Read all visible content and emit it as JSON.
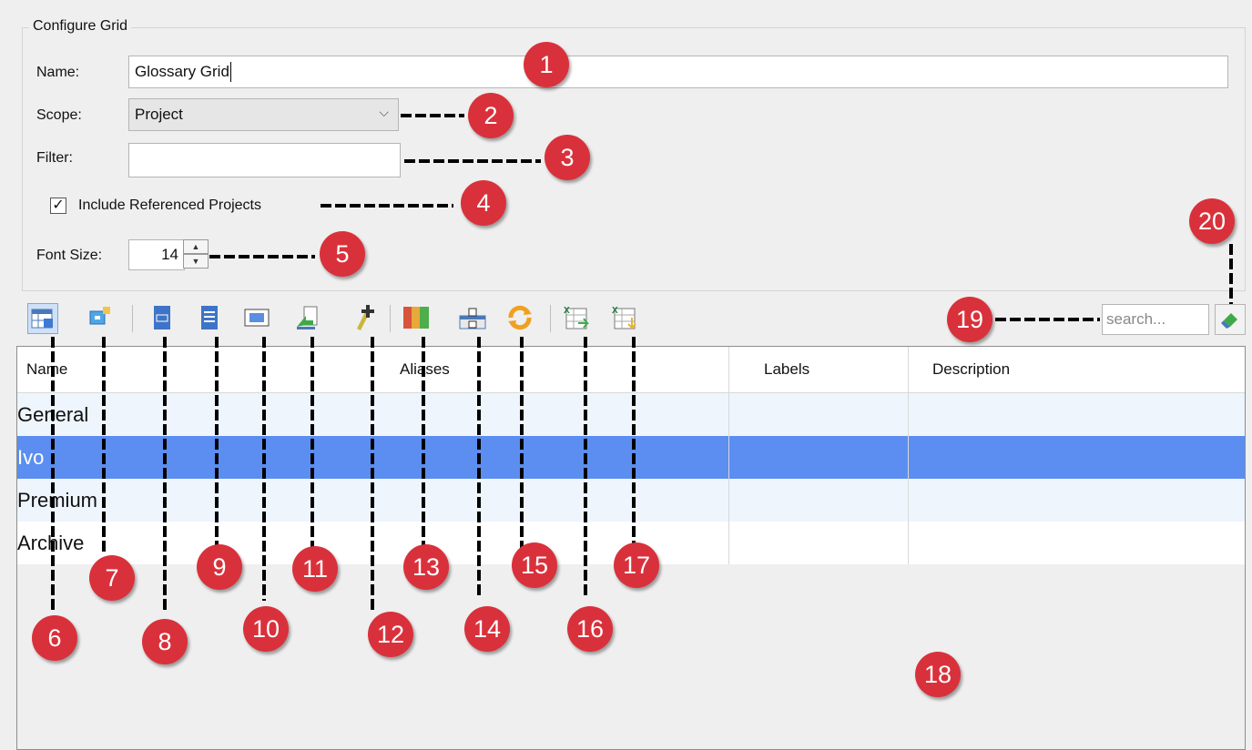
{
  "group_title": "Configure Grid",
  "name_label": "Name:",
  "name_value": "Glossary Grid",
  "scope_label": "Scope:",
  "scope_value": "Project",
  "filter_label": "Filter:",
  "filter_value": "",
  "include_ref_label": "Include Referenced Projects",
  "include_ref_checked": true,
  "font_size_label": "Font Size:",
  "font_size_value": "14",
  "search_placeholder": "search...",
  "columns": [
    "Name",
    "Aliases",
    "Labels",
    "Description"
  ],
  "rows": [
    "General",
    "Ivo",
    "Premium",
    "Archive"
  ],
  "selected_row": "Ivo",
  "toolbar_icons": [
    "show-grid-icon",
    "configure-columns-icon",
    "new-element-icon",
    "open-spec-icon",
    "show-in-diagram-icon",
    "export-icon",
    "add-item-icon",
    "color-columns-icon",
    "filter-checklist-icon",
    "refresh-icon",
    "export-excel-icon",
    "import-excel-icon"
  ],
  "callouts": [
    "1",
    "2",
    "3",
    "4",
    "5",
    "6",
    "7",
    "8",
    "9",
    "10",
    "11",
    "12",
    "13",
    "14",
    "15",
    "16",
    "17",
    "18",
    "19",
    "20"
  ],
  "colors": {
    "selection": "#5b8ef0",
    "alt_row": "#eef5fd",
    "callout": "#d9313b"
  }
}
